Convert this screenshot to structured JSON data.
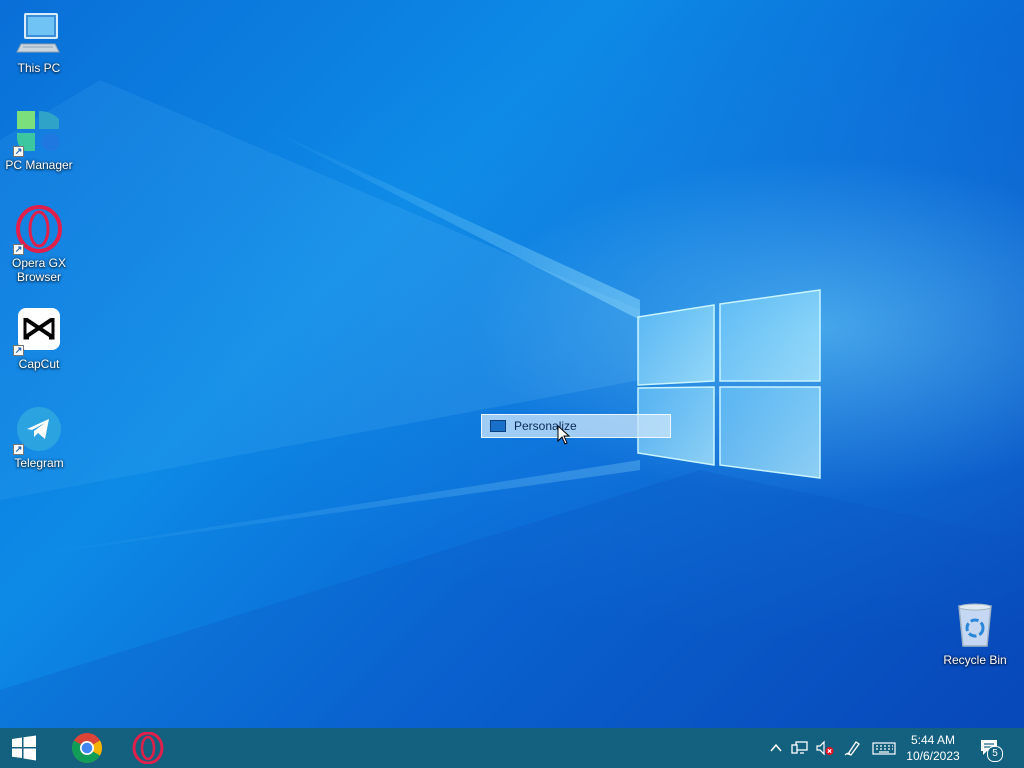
{
  "desktop_icons": [
    {
      "label": "This PC",
      "icon": "this-pc-icon"
    },
    {
      "label": "PC Manager",
      "icon": "pc-manager-icon"
    },
    {
      "label": "Opera GX\nBrowser",
      "icon": "opera-gx-icon"
    },
    {
      "label": "CapCut",
      "icon": "capcut-icon"
    },
    {
      "label": "Telegram",
      "icon": "telegram-icon"
    },
    {
      "label": "Recycle Bin",
      "icon": "recycle-bin-icon"
    }
  ],
  "context_menu": {
    "item_label": "Personalize",
    "icon": "personalize-icon"
  },
  "taskbar": {
    "start_icon": "windows-start-icon",
    "pinned": [
      {
        "name": "Google Chrome",
        "icon": "chrome-icon"
      },
      {
        "name": "Opera",
        "icon": "opera-icon"
      }
    ],
    "tray": {
      "time": "5:44 AM",
      "date": "10/6/2023",
      "notification_count": "5"
    }
  },
  "colors": {
    "accent": "#0078d7",
    "taskbar": "#14607f"
  }
}
